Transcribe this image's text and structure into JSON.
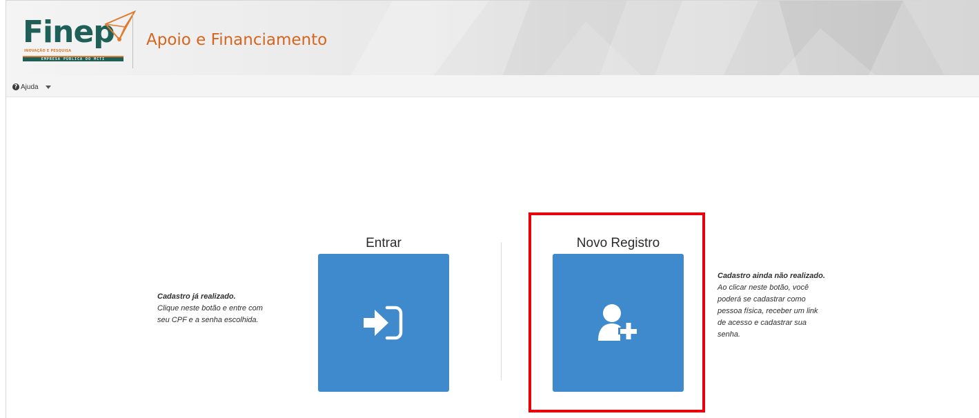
{
  "header": {
    "logo": {
      "wordmark": "Finep",
      "tagline": "INOVAÇÃO E PESQUISA",
      "bar_text": "EMPRESA PÚBLICA DO MCTI"
    },
    "app_title": "Apoio e Financiamento"
  },
  "menubar": {
    "help_label": "Ajuda"
  },
  "login": {
    "title": "Entrar",
    "description_lead": "Cadastro já realizado.",
    "description_lines": [
      "Clique neste botão e entre com",
      "seu CPF e a senha escolhida."
    ]
  },
  "register": {
    "title": "Novo Registro",
    "description_lead": "Cadastro ainda não realizado.",
    "description_lines": [
      "Ao clicar neste botão, você",
      "poderá se cadastrar como",
      "pessoa física, receber um link",
      "de acesso e cadastrar sua",
      "senha."
    ]
  },
  "colors": {
    "tile_blue": "#3f8acc",
    "brand_orange": "#d4661f",
    "brand_green": "#1e5f57",
    "highlight_red": "#e8000b"
  },
  "icons": {
    "login": "sign-in-icon",
    "register": "user-plus-icon",
    "help": "question-circle-icon"
  }
}
